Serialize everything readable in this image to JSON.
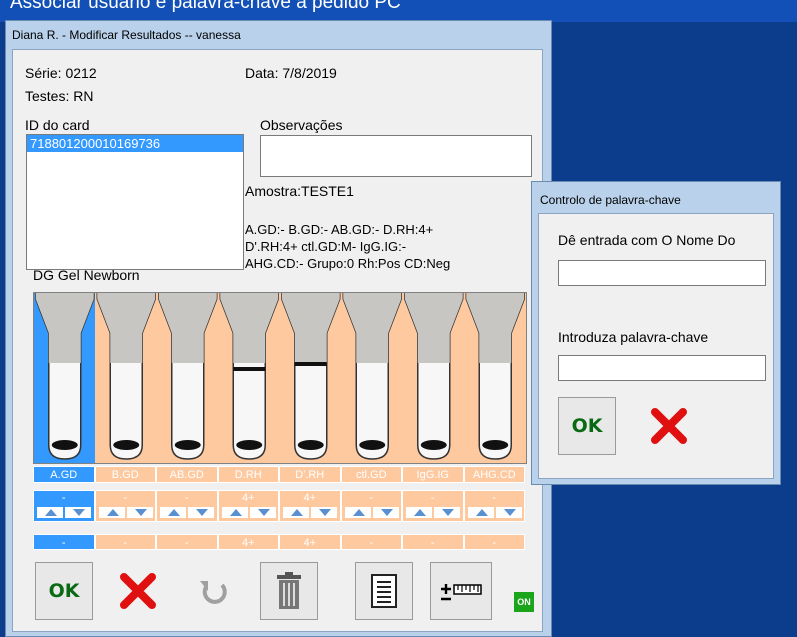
{
  "background_caption": "Associar usuário e palavra-chave a pedido PC",
  "window": {
    "title": "Diana R. - Modificar Resultados -- vanessa",
    "serie": "Série: 0212",
    "data": "Data: 7/8/2019",
    "testes": "Testes: RN",
    "id_label": "ID do card",
    "id_selected": "718801200010169736",
    "obs_label": "Observações",
    "amostra": "Amostra:TESTE1",
    "result_line1": "A.GD:-  B.GD:-  AB.GD:-  D.RH:4+",
    "result_line2": "D'.RH:4+  ctl.GD:M-  IgG.IG:-",
    "result_line3": "AHG.CD:-  Grupo:0  Rh:Pos  CD:Neg",
    "card_name": "DG Gel Newborn",
    "columns": [
      {
        "label": "A.GD",
        "value": "-",
        "result": "-"
      },
      {
        "label": "B.GD",
        "value": "-",
        "result": "-"
      },
      {
        "label": "AB.GD",
        "value": "-",
        "result": "-"
      },
      {
        "label": "D.RH",
        "value": "4+",
        "result": "4+"
      },
      {
        "label": "D'.RH",
        "value": "4+",
        "result": "4+"
      },
      {
        "label": "ctl.GD",
        "value": "-",
        "result": "-"
      },
      {
        "label": "IgG.IG",
        "value": "-",
        "result": "-"
      },
      {
        "label": "AHG.CD",
        "value": "-",
        "result": "-"
      }
    ],
    "buttons": {
      "ok_label": "OK",
      "on_badge": "ON"
    },
    "colors": {
      "selected": "#3399ff",
      "panel": "#ffc9a0",
      "ok_green": "#0a6a14",
      "cancel_red": "#e01010"
    }
  },
  "dialog": {
    "title": "Controlo de palavra-chave",
    "name_label": "Dê entrada com O Nome Do",
    "name_value": "",
    "password_label": "Introduza palavra-chave",
    "password_value": "",
    "ok_label": "OK"
  }
}
